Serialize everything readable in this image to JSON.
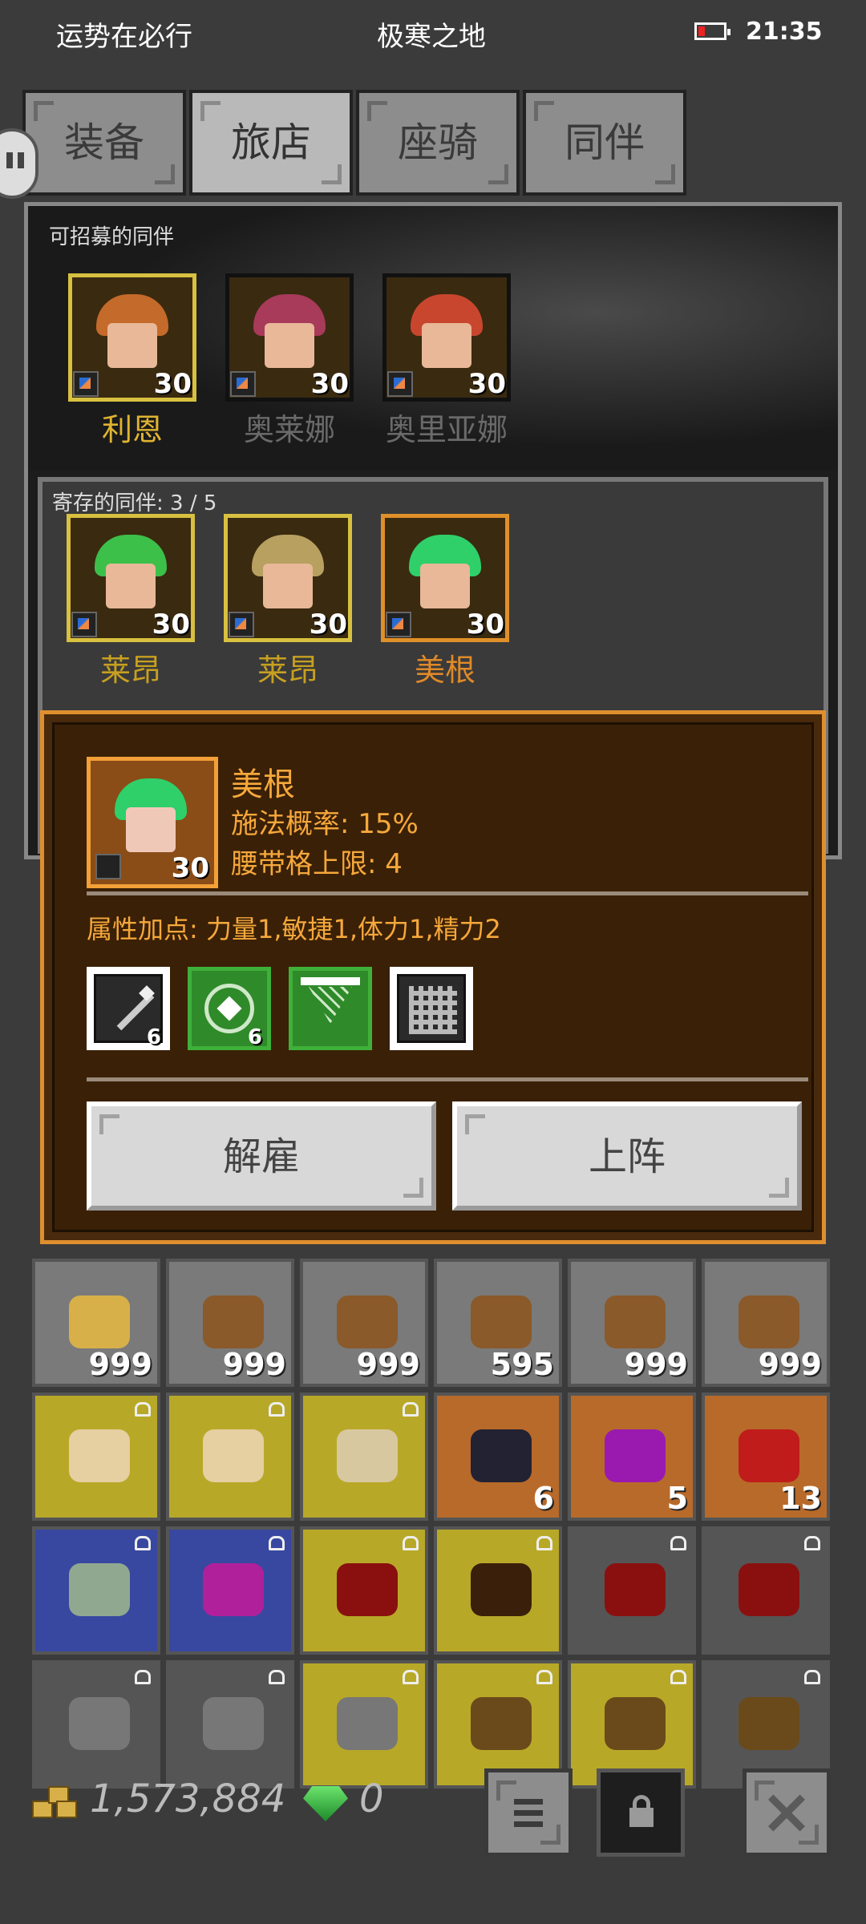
{
  "status": {
    "left_text": "运势在必行",
    "center_text": "极寒之地",
    "time": "21:35"
  },
  "tabs": [
    {
      "label": "装备",
      "active": false
    },
    {
      "label": "旅店",
      "active": true
    },
    {
      "label": "座骑",
      "active": false
    },
    {
      "label": "同伴",
      "active": false
    }
  ],
  "recruitable": {
    "title": "可招募的同伴",
    "companions": [
      {
        "name": "利恩",
        "level": "30",
        "hair": "#c46a2a",
        "frame": "#d8c040",
        "name_color": "#e0b430"
      },
      {
        "name": "奥莱娜",
        "level": "30",
        "hair": "#a83a5a",
        "frame": "#111111",
        "name_color": "#6a6a6a"
      },
      {
        "name": "奥里亚娜",
        "level": "30",
        "hair": "#c8462e",
        "frame": "#111111",
        "name_color": "#6a6a6a"
      }
    ]
  },
  "stored": {
    "title": "寄存的同伴: 3 / 5",
    "companions": [
      {
        "name": "莱昂",
        "level": "30",
        "hair": "#3cc04a",
        "frame": "#d8c040",
        "name_color": "#c8a020"
      },
      {
        "name": "莱昂",
        "level": "30",
        "hair": "#b8a060",
        "frame": "#d8c040",
        "name_color": "#c8a020"
      },
      {
        "name": "美根",
        "level": "30",
        "hair": "#2fcf6a",
        "frame": "#e0902a",
        "name_color": "#e08a28"
      }
    ]
  },
  "dialog": {
    "name": "美根",
    "level": "30",
    "cast_rate": "施法概率: 15%",
    "belt_limit": "腰带格上限: 4",
    "attributes": "属性加点: 力量1,敏捷1,体力1,精力2",
    "skills": [
      {
        "icon": "staff-skill-icon",
        "count": "6",
        "style": "white"
      },
      {
        "icon": "burst-skill-icon",
        "count": "6",
        "style": "green"
      },
      {
        "icon": "web-skill-icon",
        "count": "",
        "style": "green"
      },
      {
        "icon": "runes-skill-icon",
        "count": "",
        "style": "white"
      }
    ],
    "dismiss_label": "解雇",
    "deploy_label": "上阵"
  },
  "inventory": {
    "row1": [
      {
        "icon": "gold-ore-icon",
        "qty": "999",
        "color": "#d8b04a"
      },
      {
        "icon": "copper-ore-icon",
        "qty": "999",
        "color": "#8a5a2a"
      },
      {
        "icon": "copper-ore-icon",
        "qty": "999",
        "color": "#8a5a2a"
      },
      {
        "icon": "copper-ore-icon",
        "qty": "595",
        "color": "#8a5a2a"
      },
      {
        "icon": "copper-ore-icon",
        "qty": "999",
        "color": "#8a5a2a"
      },
      {
        "icon": "copper-ore-icon",
        "qty": "999",
        "color": "#8a5a2a"
      }
    ],
    "row2": [
      {
        "icon": "crossed-swords-icon",
        "qty": "",
        "bg": "#b8a828",
        "color": "#e6cfa0",
        "locked": true
      },
      {
        "icon": "crossed-swords-icon",
        "qty": "",
        "bg": "#b8a828",
        "color": "#e6cfa0",
        "locked": true
      },
      {
        "icon": "skull-armor-icon",
        "qty": "",
        "bg": "#b8a828",
        "color": "#d8c8a0",
        "locked": true
      },
      {
        "icon": "black-gem-icon",
        "qty": "6",
        "bg": "#b86a2a",
        "color": "#222233",
        "locked": false
      },
      {
        "icon": "purple-gem-icon",
        "qty": "5",
        "bg": "#b86a2a",
        "color": "#9a1ab0",
        "locked": false
      },
      {
        "icon": "red-gem-icon",
        "qty": "13",
        "bg": "#b86a2a",
        "color": "#c01c1c",
        "locked": false
      }
    ],
    "row3": [
      {
        "icon": "scroll-map-icon",
        "qty": "",
        "bg": "#3848a0",
        "color": "#90a890",
        "locked": true
      },
      {
        "icon": "amulet-icon",
        "qty": "",
        "bg": "#3848a0",
        "color": "#b0209a",
        "locked": true
      },
      {
        "icon": "red-armor-icon",
        "qty": "",
        "bg": "#b8a828",
        "color": "#8a1010",
        "locked": true
      },
      {
        "icon": "dark-armor-icon",
        "qty": "",
        "bg": "#b8a828",
        "color": "#3a200a",
        "locked": true
      },
      {
        "icon": "red-armor-icon",
        "qty": "",
        "bg": "#555555",
        "color": "#8a1010",
        "locked": true
      },
      {
        "icon": "red-armor-icon",
        "qty": "",
        "bg": "#555555",
        "color": "#8a1010",
        "locked": true
      }
    ],
    "row4": [
      {
        "icon": "chain-icon",
        "qty": "",
        "bg": "#555555",
        "color": "#777777",
        "locked": true
      },
      {
        "icon": "chain-icon",
        "qty": "",
        "bg": "#555555",
        "color": "#777777",
        "locked": true
      },
      {
        "icon": "chain-icon",
        "qty": "",
        "bg": "#b8a828",
        "color": "#777777",
        "locked": true
      },
      {
        "icon": "bow-icon",
        "qty": "",
        "bg": "#b8a828",
        "color": "#6a4a1a",
        "locked": true
      },
      {
        "icon": "bow-icon",
        "qty": "",
        "bg": "#b8a828",
        "color": "#6a4a1a",
        "locked": true
      },
      {
        "icon": "bow-icon",
        "qty": "",
        "bg": "#555555",
        "color": "#6a4a1a",
        "locked": true
      }
    ]
  },
  "footer": {
    "gold": "1,573,884",
    "gems": "0"
  }
}
